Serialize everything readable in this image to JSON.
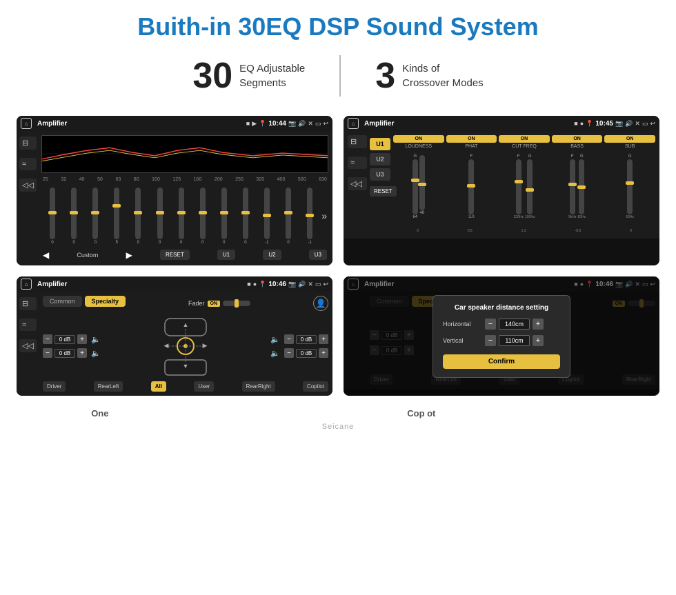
{
  "page": {
    "title": "Buith-in 30EQ DSP Sound System",
    "stats": [
      {
        "number": "30",
        "label_line1": "EQ Adjustable",
        "label_line2": "Segments"
      },
      {
        "number": "3",
        "label_line1": "Kinds of",
        "label_line2": "Crossover Modes"
      }
    ],
    "watermark": "Seicane"
  },
  "screen1": {
    "title": "Amplifier",
    "time": "10:44",
    "freq_labels": [
      "25",
      "32",
      "40",
      "50",
      "63",
      "80",
      "100",
      "125",
      "160",
      "200",
      "250",
      "320",
      "400",
      "500",
      "630"
    ],
    "eq_values": [
      "0",
      "0",
      "0",
      "5",
      "0",
      "0",
      "0",
      "0",
      "0",
      "0",
      "-1",
      "0",
      "-1"
    ],
    "custom_label": "Custom",
    "reset_btn": "RESET",
    "u1_btn": "U1",
    "u2_btn": "U2",
    "u3_btn": "U3"
  },
  "screen2": {
    "title": "Amplifier",
    "time": "10:45",
    "u1_btn": "U1",
    "u2_btn": "U2",
    "u3_btn": "U3",
    "channels": [
      {
        "label": "LOUDNESS",
        "on": true
      },
      {
        "label": "PHAT",
        "on": true
      },
      {
        "label": "CUT FREQ",
        "on": true
      },
      {
        "label": "BASS",
        "on": true
      },
      {
        "label": "SUB",
        "on": true
      }
    ],
    "reset_btn": "RESET"
  },
  "screen3": {
    "title": "Amplifier",
    "time": "10:46",
    "tab_common": "Common",
    "tab_specialty": "Specialty",
    "fader_label": "Fader",
    "fader_on": "ON",
    "db_values": [
      "0 dB",
      "0 dB",
      "0 dB",
      "0 dB"
    ],
    "btn_driver": "Driver",
    "btn_rear_left": "RearLeft",
    "btn_all": "All",
    "btn_user": "User",
    "btn_rear_right": "RearRight",
    "btn_copilot": "Copilot"
  },
  "screen4": {
    "title": "Amplifier",
    "time": "10:46",
    "tab_common": "Common",
    "tab_specialty": "Specialty",
    "modal_title": "Car speaker distance setting",
    "horizontal_label": "Horizontal",
    "horizontal_value": "140cm",
    "vertical_label": "Vertical",
    "vertical_value": "110cm",
    "confirm_btn": "Confirm",
    "db_values": [
      "0 dB",
      "0 dB"
    ],
    "btn_driver": "Driver",
    "btn_rear_left": "RearLeft",
    "btn_copilot": "Copilot",
    "btn_rear_right": "RearRight"
  },
  "bottom_labels": [
    {
      "text": "One"
    },
    {
      "text": ""
    },
    {
      "text": "Cop ot"
    },
    {
      "text": ""
    }
  ]
}
